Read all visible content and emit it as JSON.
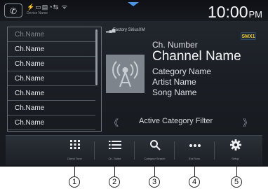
{
  "status": {
    "phone_icon": "phone-icon",
    "icons_text": "⚡▭▤◔⇆ ᯤ",
    "device_name": "Device Name",
    "time": "10:00",
    "ampm": "PM"
  },
  "channel_list": {
    "items": [
      {
        "label": "Ch.Name",
        "dim": true
      },
      {
        "label": "Ch.Name"
      },
      {
        "label": "Ch.Name"
      },
      {
        "label": "Ch.Name"
      },
      {
        "label": "Ch.Name"
      },
      {
        "label": "Ch.Name"
      },
      {
        "label": "Ch.Name"
      }
    ]
  },
  "now_playing": {
    "source": "Factory SiriusXM",
    "badge": "SMX1",
    "ch_number": "Ch. Number",
    "channel_name": "Channel Name",
    "category": "Category Name",
    "artist": "Artist Name",
    "song": "Song Name"
  },
  "filter": {
    "prev": "《",
    "label": "Active Category Filter",
    "next": "》"
  },
  "toolbar": {
    "buttons": [
      {
        "icon": "direct-tune-icon",
        "label": "Direct Tune",
        "callout": "1"
      },
      {
        "icon": "channel-guide-icon",
        "label": "Ch. Guide",
        "callout": "2"
      },
      {
        "icon": "category-search-icon",
        "label": "Category Search",
        "callout": "3"
      },
      {
        "icon": "ext-func-icon",
        "label": "Ext.Func.",
        "callout": "4"
      },
      {
        "icon": "setup-icon",
        "label": "Setup",
        "callout": "5"
      }
    ]
  }
}
